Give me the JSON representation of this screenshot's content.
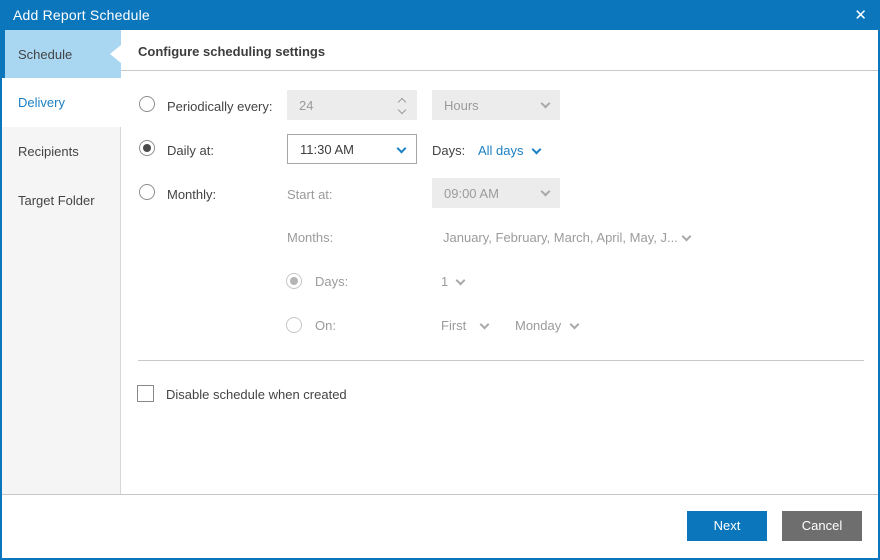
{
  "titlebar": {
    "title": "Add Report Schedule",
    "close_icon": "✕"
  },
  "sidebar": {
    "items": [
      {
        "label": "Schedule",
        "state": "active"
      },
      {
        "label": "Delivery",
        "state": "link"
      },
      {
        "label": "Recipients",
        "state": "normal"
      },
      {
        "label": "Target Folder",
        "state": "normal"
      }
    ]
  },
  "content": {
    "heading": "Configure scheduling settings",
    "periodic": {
      "label": "Periodically every:",
      "value": "24",
      "unit": "Hours"
    },
    "daily": {
      "label": "Daily at:",
      "time": "11:30 AM",
      "days_label": "Days:",
      "days_value": "All days"
    },
    "monthly": {
      "label": "Monthly:",
      "start_label": "Start at:",
      "start_value": "09:00 AM",
      "months_label": "Months:",
      "months_value": "January, February, March, April, May, J...",
      "days_label": "Days:",
      "days_value": "1",
      "on_label": "On:",
      "on_ordinal": "First",
      "on_weekday": "Monday"
    },
    "disable_label": "Disable schedule when created"
  },
  "footer": {
    "next": "Next",
    "cancel": "Cancel"
  },
  "colors": {
    "titlebar_blue": "#0b76bb",
    "active_tab_bg": "#a9d7f2",
    "link_blue": "#1d80c4",
    "cancel_gray": "#6e6e6e",
    "disabled_bg": "#ececec",
    "disabled_text": "#9b9b9b",
    "text": "#444444",
    "sidebar_bg": "#f5f5f5"
  }
}
